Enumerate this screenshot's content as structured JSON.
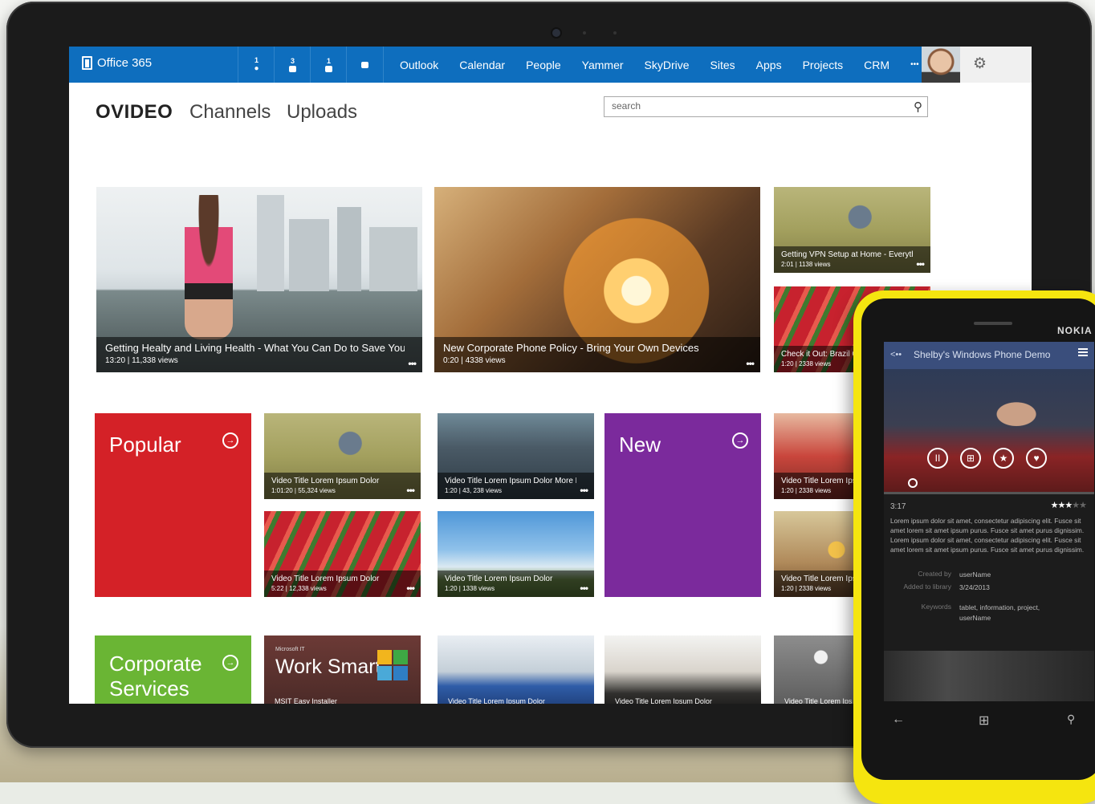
{
  "suitebar": {
    "brand": "Office 365",
    "notifications": [
      {
        "count": "1",
        "icon": "alert-icon"
      },
      {
        "count": "3",
        "icon": "calendar-icon"
      },
      {
        "count": "1",
        "icon": "chat-icon"
      },
      {
        "count": "",
        "icon": "mail-icon"
      }
    ],
    "nav": [
      "Outlook",
      "Calendar",
      "People",
      "Yammer",
      "SkyDrive",
      "Sites",
      "Apps",
      "Projects",
      "CRM",
      "•••"
    ],
    "accent": "#0e6ebe"
  },
  "header": {
    "brand": "OVIDEO",
    "tabs": [
      "Channels",
      "Uploads"
    ],
    "search_placeholder": "search"
  },
  "hero": [
    {
      "title": "Getting Healty and Living Health - What You Can Do to Save Your...",
      "meta": "13:20  |  11,338 views",
      "more": "•••"
    },
    {
      "title": "New Corporate Phone Policy - Bring Your Own Devices",
      "meta": "0:20  |  4338 views",
      "more": "•••"
    }
  ],
  "side_videos": [
    {
      "title": "Getting VPN Setup at Home - Everything ...",
      "meta": "2:01  |  1138 views",
      "more": "•••"
    },
    {
      "title": "Check it Out: Brazil Ol",
      "meta": "1:20  |  2338 views",
      "more": ""
    }
  ],
  "categories": {
    "popular": {
      "label": "Popular",
      "color": "#d42127"
    },
    "new": {
      "label": "New",
      "color": "#7b2a9c"
    },
    "corporate": {
      "label": "Corporate Services",
      "color": "#6ab534"
    }
  },
  "grid_videos": [
    {
      "title": "Video Title Lorem Ipsum Dolor",
      "meta": "1:01:20  |  55,324 views",
      "more": "•••"
    },
    {
      "title": "Video Title Lorem Ipsum Dolor More Long...",
      "meta": "1:20  |  43, 238 views",
      "more": "•••"
    },
    {
      "title": "Video Title Lorem Ips",
      "meta": "1:20  |  2338 views",
      "more": ""
    },
    {
      "title": "Video Title Lorem Ipsum Dolor",
      "meta": "5:22  |  12,338 views",
      "more": "•••"
    },
    {
      "title": "Video Title Lorem Ipsum Dolor",
      "meta": "1:20  |  1338 views",
      "more": "•••"
    },
    {
      "title": "Video Title Lorem Ips",
      "meta": "1:20  |  2338 views",
      "more": ""
    }
  ],
  "bottom_row": {
    "worksmart_small": "Microsoft IT",
    "worksmart_title": "Work Smart",
    "worksmart_caption": "MSIT Easy Installer",
    "videos": [
      "Video Title Lorem Ipsum Dolor",
      "Video Title Lorem Ipsum Dolor",
      "Video Title Lorem Ips"
    ]
  },
  "phone": {
    "brand": "NOKIA",
    "title": "Shelby's Windows Phone Demo",
    "time": "3:17",
    "rating_stars": 3,
    "rating_max": 5,
    "description": "Lorem ipsum dolor sit amet, consectetur adipiscing elit. Fusce sit amet lorem sit amet ipsum purus. Fusce sit amet purus dignissim. Lorem ipsum dolor sit amet, consectetur adipiscing elit. Fusce sit amet lorem sit amet ipsum purus. Fusce sit amet purus dignissim.",
    "meta": [
      {
        "key": "Created by",
        "value": "userName"
      },
      {
        "key": "Added to library",
        "value": "3/24/2013"
      },
      {
        "key": "Keywords",
        "value": "tablet, information, project, userName"
      }
    ]
  }
}
